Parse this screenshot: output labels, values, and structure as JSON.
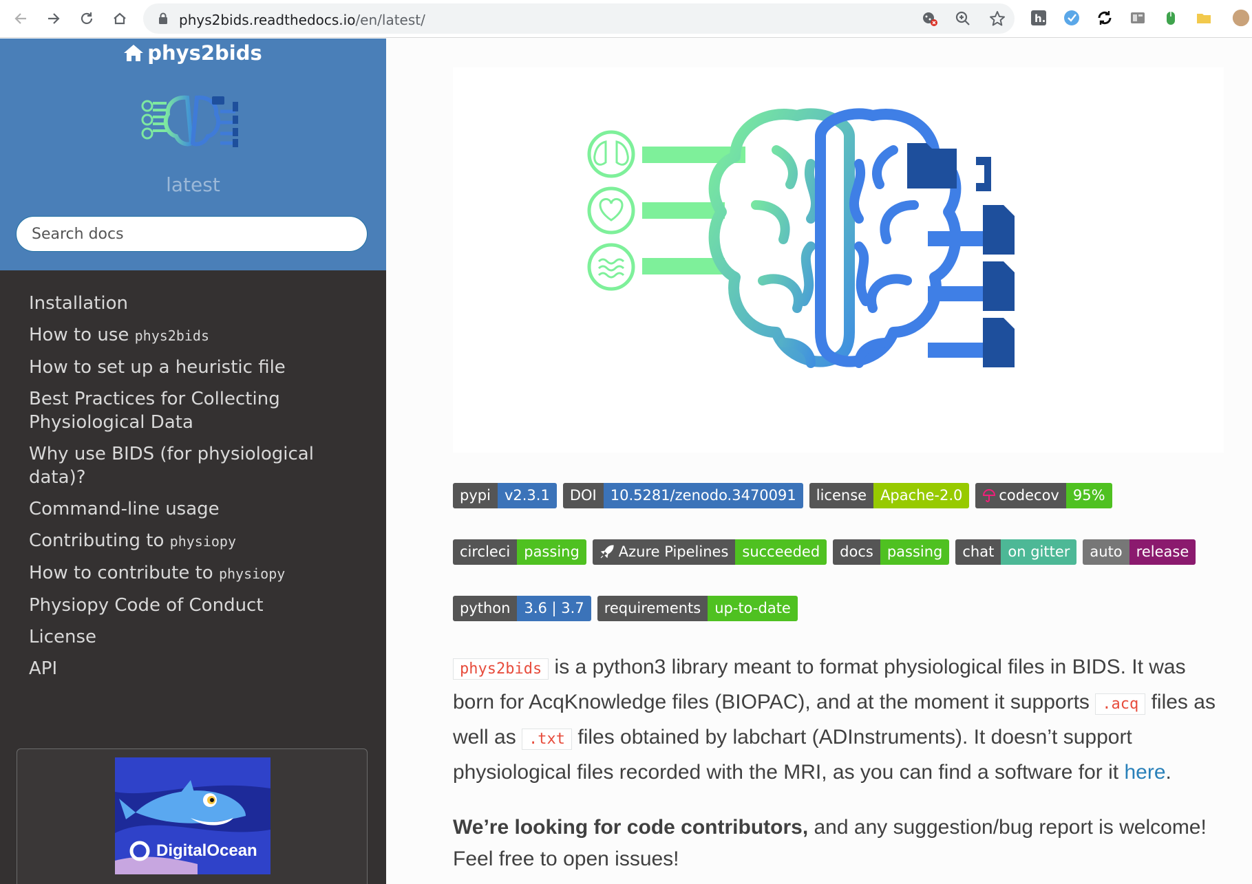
{
  "browser": {
    "url_host": "phys2bids.readthedocs.io",
    "url_path": "/en/latest/"
  },
  "sidebar": {
    "project_name": "phys2bids",
    "version": "latest",
    "search_placeholder": "Search docs",
    "nav": [
      {
        "text": "Installation",
        "code": ""
      },
      {
        "text": "How to use ",
        "code": "phys2bids"
      },
      {
        "text": "How to set up a heuristic file",
        "code": ""
      },
      {
        "text": "Best Practices for Collecting Physiological Data",
        "code": ""
      },
      {
        "text": "Why use BIDS (for physiological data)?",
        "code": ""
      },
      {
        "text": "Command-line usage",
        "code": ""
      },
      {
        "text": "Contributing to ",
        "code": "physiopy"
      },
      {
        "text": "How to contribute to ",
        "code": "physiopy"
      },
      {
        "text": "Physiopy Code of Conduct",
        "code": ""
      },
      {
        "text": "License",
        "code": ""
      },
      {
        "text": "API",
        "code": ""
      }
    ],
    "ad_label": "DigitalOcean"
  },
  "badges": {
    "row1": [
      {
        "left": "pypi",
        "right": "v2.3.1",
        "color": "#3b73b9"
      },
      {
        "left": "DOI",
        "right": "10.5281/zenodo.3470091",
        "color": "#3b73b9"
      },
      {
        "left": "license",
        "right": "Apache-2.0",
        "color": "#97ca00"
      },
      {
        "left": "codecov",
        "right": "95%",
        "color": "#4fc121"
      }
    ],
    "row2": [
      {
        "left": "circleci",
        "right": "passing",
        "color": "#4fc121"
      },
      {
        "left": "Azure Pipelines",
        "right": "succeeded",
        "color": "#4fc121"
      },
      {
        "left": "docs",
        "right": "passing",
        "color": "#4fc121"
      },
      {
        "left": "chat",
        "right": "on gitter",
        "color": "#4db896"
      },
      {
        "left": "auto",
        "right": "release",
        "color": "#8b1a6e"
      }
    ],
    "row3": [
      {
        "left": "python",
        "right": "3.6 | 3.7",
        "color": "#3b73b9"
      },
      {
        "left": "requirements",
        "right": "up-to-date",
        "color": "#4fc121"
      }
    ]
  },
  "content": {
    "p1_code1": "phys2bids",
    "p1_t1": " is a python3 library meant to format physiological files in BIDS. It was born for AcqKnowledge files (BIOPAC), and at the moment it supports ",
    "p1_code2": ".acq",
    "p1_t2": " files as well as ",
    "p1_code3": ".txt",
    "p1_t3": " files obtained by labchart (ADInstruments). It doesn’t support physiological files recorded with the MRI, as you can find a software for it ",
    "p1_link": "here",
    "p1_t4": ".",
    "p2_strong": "We’re looking for code contributors,",
    "p2_text": " and any suggestion/bug report is welcome! Feel free to open issues!"
  },
  "colors": {
    "sidebar_top": "#4a7fb8",
    "sidebar_bg": "#343131",
    "link": "#2980b9",
    "code": "#e74c3c"
  }
}
